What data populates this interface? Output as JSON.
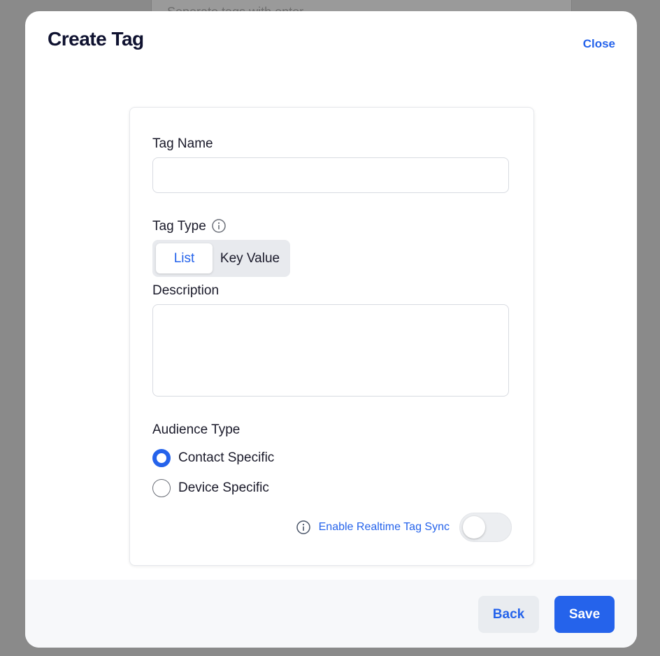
{
  "background": {
    "placeholder": "Seperate tags with enter"
  },
  "modal": {
    "title": "Create Tag",
    "close_label": "Close"
  },
  "form": {
    "tag_name": {
      "label": "Tag Name",
      "value": ""
    },
    "tag_type": {
      "label": "Tag Type",
      "options": [
        "List",
        "Key Value"
      ],
      "selected": "List"
    },
    "description": {
      "label": "Description",
      "value": ""
    },
    "audience_type": {
      "label": "Audience Type",
      "options": [
        "Contact Specific",
        "Device Specific"
      ],
      "selected": "Contact Specific"
    },
    "realtime_sync": {
      "label": "Enable Realtime Tag Sync",
      "enabled": false
    }
  },
  "footer": {
    "back_label": "Back",
    "save_label": "Save"
  },
  "colors": {
    "accent": "#2563eb",
    "title": "#0f1230",
    "overlay": "#8a8a8a"
  }
}
